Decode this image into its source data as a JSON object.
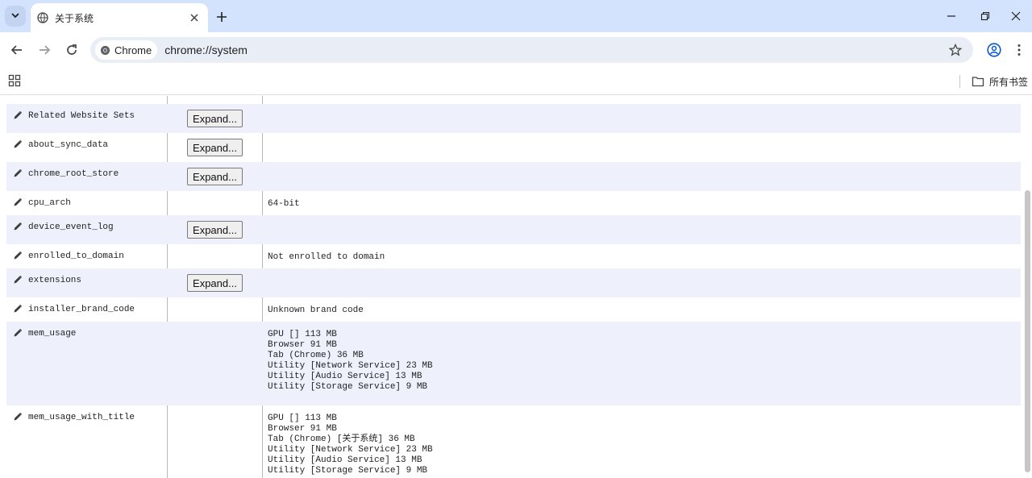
{
  "browser": {
    "tab_title": "关于系统",
    "url_chip_label": "Chrome",
    "url": "chrome://system",
    "bookmark_folder": "所有书签"
  },
  "table": {
    "expand_label": "Expand...",
    "rows": [
      {
        "key": "Related Website Sets",
        "has_expand": true,
        "lines": []
      },
      {
        "key": "about_sync_data",
        "has_expand": true,
        "lines": []
      },
      {
        "key": "chrome_root_store",
        "has_expand": true,
        "lines": []
      },
      {
        "key": "cpu_arch",
        "has_expand": false,
        "lines": [
          "64-bit"
        ]
      },
      {
        "key": "device_event_log",
        "has_expand": true,
        "lines": []
      },
      {
        "key": "enrolled_to_domain",
        "has_expand": false,
        "lines": [
          "Not enrolled to domain"
        ]
      },
      {
        "key": "extensions",
        "has_expand": true,
        "lines": []
      },
      {
        "key": "installer_brand_code",
        "has_expand": false,
        "lines": [
          "Unknown brand code"
        ]
      },
      {
        "key": "mem_usage",
        "has_expand": false,
        "lines": [
          "GPU [] 113 MB",
          "Browser 91 MB",
          "Tab (Chrome) 36 MB",
          "Utility [Network Service] 23 MB",
          "Utility [Audio Service] 13 MB",
          "Utility [Storage Service] 9 MB"
        ]
      },
      {
        "key": "mem_usage_with_title",
        "has_expand": false,
        "lines": [
          "GPU [] 113 MB",
          "Browser 91 MB",
          "Tab (Chrome) [关于系统] 36 MB",
          "Utility [Network Service] 23 MB",
          "Utility [Audio Service] 13 MB",
          "Utility [Storage Service] 9 MB"
        ]
      }
    ]
  }
}
